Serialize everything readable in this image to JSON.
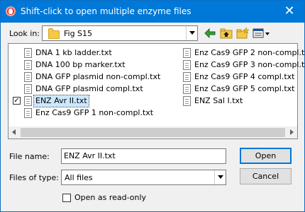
{
  "dialog": {
    "title": "Shift-click to open multiple enzyme files",
    "close_glyph": "✕"
  },
  "lookin": {
    "label": "Look in:",
    "value": "Fig S15",
    "folder_icon": "folder-icon"
  },
  "toolbar": {
    "back_icon": "arrow-left-icon",
    "up_icon": "folder-up-icon",
    "new_folder_icon": "new-folder-icon",
    "view_menu_icon": "view-menu-icon"
  },
  "files": {
    "column1": [
      {
        "name": "DNA 1 kb ladder.txt",
        "selected": false
      },
      {
        "name": "DNA 100 bp marker.txt",
        "selected": false
      },
      {
        "name": "DNA GFP plasmid  non-compl.txt",
        "selected": false
      },
      {
        "name": "DNA GFP plasmid compl.txt",
        "selected": false
      },
      {
        "name": "ENZ Avr II.txt",
        "selected": true,
        "checked": true
      },
      {
        "name": "Enz Cas9 GFP 1 non-compl.txt",
        "selected": false
      }
    ],
    "column2": [
      {
        "name": "Enz Cas9 GFP 2 non-compl.txt",
        "selected": false
      },
      {
        "name": "Enz Cas9 GFP 3 non-compl.txt",
        "selected": false
      },
      {
        "name": "Enz Cas9 GFP 4 compl.txt",
        "selected": false
      },
      {
        "name": "Enz Cas9 GFP 5 compl.txt",
        "selected": false
      },
      {
        "name": "ENZ Sal I.txt",
        "selected": false
      }
    ]
  },
  "filename": {
    "label": "File name:",
    "value": "ENZ Avr II.txt"
  },
  "filetype": {
    "label": "Files of type:",
    "value": "All files"
  },
  "readonly": {
    "label": "Open as read-only",
    "checked": false
  },
  "buttons": {
    "open": "Open",
    "cancel": "Cancel"
  },
  "colors": {
    "titlebar": "#0078d7",
    "accent": "#0078d7"
  }
}
